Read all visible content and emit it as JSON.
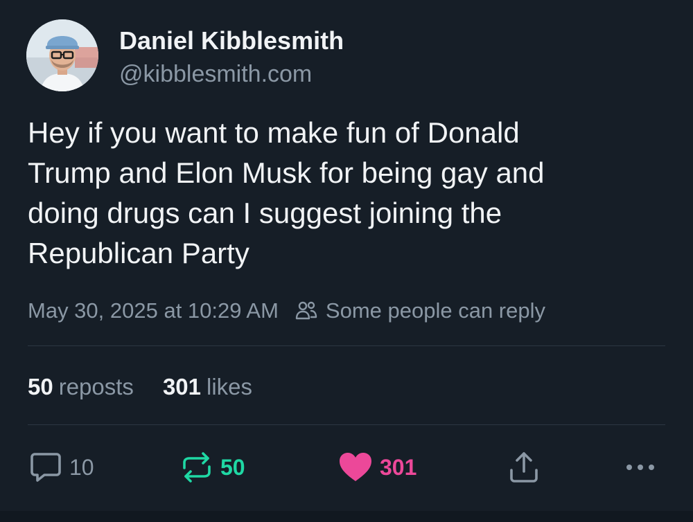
{
  "author": {
    "display_name": "Daniel Kibblesmith",
    "handle": "@kibblesmith.com"
  },
  "post": {
    "text_lines": [
      "Hey if you want to make fun of Donald",
      "Trump and Elon Musk for being gay and",
      "doing drugs can I suggest joining the",
      "Republican Party"
    ],
    "timestamp": "May 30, 2025 at 10:29 AM",
    "reply_setting": "Some people can reply"
  },
  "stats": {
    "reposts_count": "50",
    "reposts_label": "reposts",
    "likes_count": "301",
    "likes_label": "likes"
  },
  "actions": {
    "reply_count": "10",
    "repost_count": "50",
    "like_count": "301"
  },
  "icons": {
    "people": "people-icon",
    "reply": "speech-bubble-icon",
    "repost": "repost-arrows-icon",
    "like": "heart-icon",
    "share": "share-icon",
    "more": "more-dots-icon"
  },
  "colors": {
    "background": "#161e27",
    "primary_text": "#f1f3f5",
    "secondary_text": "#8b98a5",
    "repost_active": "#1fd8a4",
    "like_active": "#ec4899",
    "divider": "#2c3742"
  }
}
